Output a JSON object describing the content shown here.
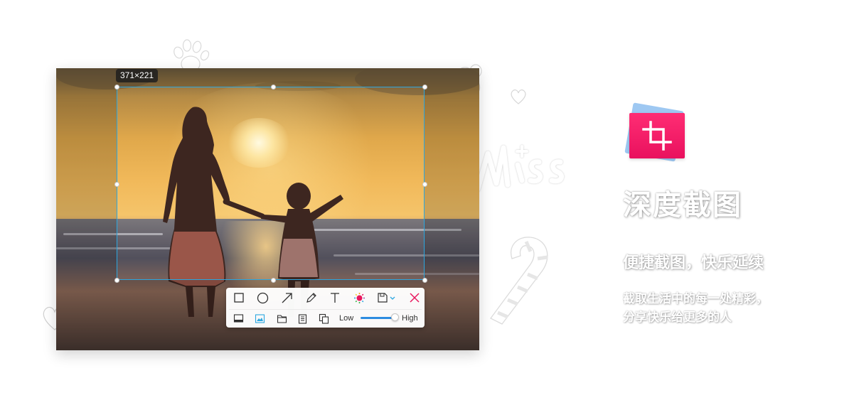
{
  "screenshot": {
    "selection_size_label": "371×221",
    "toolbar": {
      "tools": [
        {
          "name": "rectangle",
          "icon": "rectangle-icon"
        },
        {
          "name": "ellipse",
          "icon": "ellipse-icon"
        },
        {
          "name": "arrow",
          "icon": "arrow-icon"
        },
        {
          "name": "pencil",
          "icon": "pencil-icon"
        },
        {
          "name": "text",
          "icon": "text-icon"
        },
        {
          "name": "color",
          "icon": "color-palette-icon",
          "accent": "#e8175d"
        },
        {
          "name": "save",
          "icon": "save-icon"
        },
        {
          "name": "close",
          "icon": "close-icon",
          "accent": "#e8175d"
        }
      ],
      "save_options": [
        "save-to-desktop-icon",
        "save-to-pictures-icon",
        "save-to-folder-icon",
        "copy-to-clipboard-icon",
        "save-and-copy-icon"
      ],
      "quality_low_label": "Low",
      "quality_high_label": "High",
      "quality_level": 0.85,
      "accent_color": "#2ca7e0"
    }
  },
  "promo": {
    "title": "深度截图",
    "subtitle": "便捷截图，快乐延续",
    "description_line1": "截取生活中的每一处精彩，",
    "description_line2": "分享快乐给更多的人",
    "icon": "crop-icon",
    "icon_color": "#e9115e",
    "decorations": [
      "paw-icon",
      "heart-icon",
      "miss-doodle",
      "candy-cane-doodle",
      "flower-icon"
    ]
  }
}
